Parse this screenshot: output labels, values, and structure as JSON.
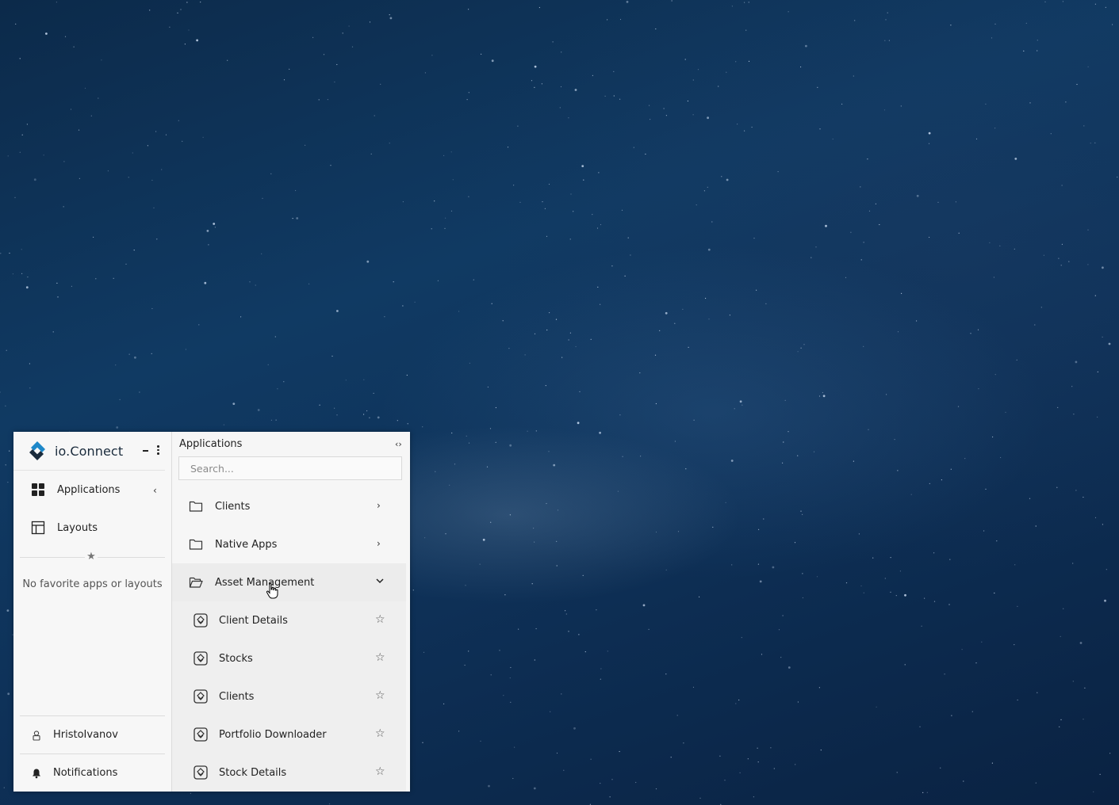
{
  "brand": {
    "name": "io.Connect"
  },
  "nav": [
    {
      "label": "Applications",
      "icon": "grid-icon",
      "active": true
    },
    {
      "label": "Layouts",
      "icon": "layout-icon"
    }
  ],
  "favorites": {
    "empty_text": "No favorite apps or layouts"
  },
  "bottom": {
    "user": "HristoIvanov",
    "notifications": "Notifications"
  },
  "apps_panel": {
    "title": "Applications",
    "search_placeholder": "Search...",
    "folders": [
      {
        "label": "Clients",
        "expanded": false
      },
      {
        "label": "Native Apps",
        "expanded": false
      },
      {
        "label": "Asset Management",
        "expanded": true
      }
    ],
    "apps": [
      {
        "label": "Client Details"
      },
      {
        "label": "Stocks"
      },
      {
        "label": "Clients"
      },
      {
        "label": "Portfolio Downloader"
      },
      {
        "label": "Stock Details"
      }
    ]
  },
  "colors": {
    "brand_blue": "#1e88c9",
    "brand_dark": "#1a2b3c",
    "panel_bg": "#f6f6f6"
  }
}
